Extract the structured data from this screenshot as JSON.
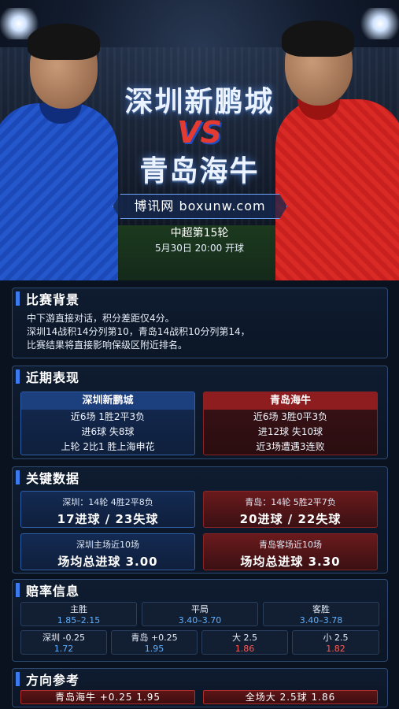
{
  "hero": {
    "team_home": "深圳新鹏城",
    "vs": "VS",
    "team_away": "青岛海牛",
    "site": "博讯网 boxunw.com",
    "round": "中超第15轮",
    "kickoff": "5月30日 20:00 开球"
  },
  "background": {
    "title": "比赛背景",
    "lines": [
      "中下游直接对话，积分差距仅4分。",
      "深圳14战积14分列第10，青岛14战积10分列第14，",
      "比赛结果将直接影响保级区附近排名。"
    ]
  },
  "form": {
    "title": "近期表现",
    "home": {
      "name": "深圳新鹏城",
      "lines": [
        "近6场 1胜2平3负",
        "进6球 失8球",
        "上轮 2比1 胜上海申花"
      ]
    },
    "away": {
      "name": "青岛海牛",
      "lines": [
        "近6场 3胜0平3负",
        "进12球 失10球",
        "近3场遭遇3连败"
      ]
    }
  },
  "key_stats": {
    "title": "关键数据",
    "home_record": "深圳：14轮 4胜2平8负",
    "home_goals": "17进球 / 23失球",
    "away_record": "青岛：14轮 5胜2平7负",
    "away_goals": "20进球 / 22失球",
    "home_recent_label": "深圳主场近10场",
    "home_recent_value": "场均总进球 3.00",
    "away_recent_label": "青岛客场近10场",
    "away_recent_value": "场均总进球 3.30"
  },
  "odds": {
    "title": "赔率信息",
    "win": {
      "label": "主胜",
      "value": "1.85–2.15"
    },
    "draw": {
      "label": "平局",
      "value": "3.40–3.70"
    },
    "lose": {
      "label": "客胜",
      "value": "3.40–3.78"
    },
    "hcp_home": {
      "label": "深圳 -0.25",
      "value": "1.72"
    },
    "hcp_away": {
      "label": "青岛 +0.25",
      "value": "1.95"
    },
    "over": {
      "label": "大 2.5",
      "value": "1.86"
    },
    "under": {
      "label": "小 2.5",
      "value": "1.82"
    },
    "colors": {
      "blue": "#5fb0ff",
      "red": "#ff5a55"
    }
  },
  "direction": {
    "title": "方向参考",
    "pick1": "青岛海牛 +0.25  1.95",
    "pick2": "全场大 2.5球  1.86"
  }
}
